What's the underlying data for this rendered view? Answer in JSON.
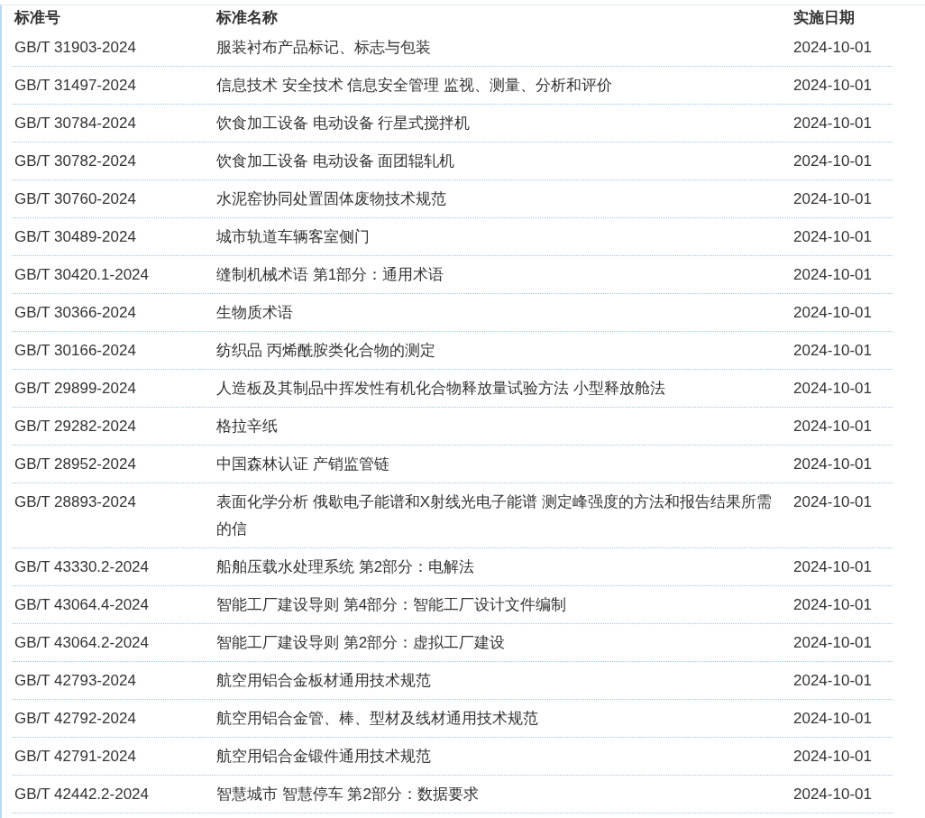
{
  "table": {
    "columns": [
      "标准号",
      "标准名称",
      "实施日期"
    ],
    "rows": [
      {
        "code": "GB/T 31903-2024",
        "name": "服装衬布产品标记、标志与包装",
        "date": "2024-10-01"
      },
      {
        "code": "GB/T 31497-2024",
        "name": "信息技术 安全技术 信息安全管理 监视、测量、分析和评价",
        "date": "2024-10-01"
      },
      {
        "code": "GB/T 30784-2024",
        "name": "饮食加工设备 电动设备 行星式搅拌机",
        "date": "2024-10-01"
      },
      {
        "code": "GB/T 30782-2024",
        "name": "饮食加工设备 电动设备 面团辊轧机",
        "date": "2024-10-01"
      },
      {
        "code": "GB/T 30760-2024",
        "name": "水泥窑协同处置固体废物技术规范",
        "date": "2024-10-01"
      },
      {
        "code": "GB/T 30489-2024",
        "name": "城市轨道车辆客室侧门",
        "date": "2024-10-01"
      },
      {
        "code": "GB/T 30420.1-2024",
        "name": "缝制机械术语 第1部分：通用术语",
        "date": "2024-10-01"
      },
      {
        "code": "GB/T 30366-2024",
        "name": "生物质术语",
        "date": "2024-10-01"
      },
      {
        "code": "GB/T 30166-2024",
        "name": "纺织品 丙烯酰胺类化合物的测定",
        "date": "2024-10-01"
      },
      {
        "code": "GB/T 29899-2024",
        "name": "人造板及其制品中挥发性有机化合物释放量试验方法 小型释放舱法",
        "date": "2024-10-01"
      },
      {
        "code": "GB/T 29282-2024",
        "name": "格拉辛纸",
        "date": "2024-10-01"
      },
      {
        "code": "GB/T 28952-2024",
        "name": "中国森林认证 产销监管链",
        "date": "2024-10-01"
      },
      {
        "code": "GB/T 28893-2024",
        "name": "表面化学分析 俄歇电子能谱和X射线光电子能谱 测定峰强度的方法和报告结果所需的信",
        "date": "2024-10-01"
      },
      {
        "code": "GB/T 43330.2-2024",
        "name": "船舶压载水处理系统 第2部分：电解法",
        "date": "2024-10-01"
      },
      {
        "code": "GB/T 43064.4-2024",
        "name": "智能工厂建设导则 第4部分：智能工厂设计文件编制",
        "date": "2024-10-01"
      },
      {
        "code": "GB/T 43064.2-2024",
        "name": "智能工厂建设导则 第2部分：虚拟工厂建设",
        "date": "2024-10-01"
      },
      {
        "code": "GB/T 42793-2024",
        "name": "航空用铝合金板材通用技术规范",
        "date": "2024-10-01"
      },
      {
        "code": "GB/T 42792-2024",
        "name": "航空用铝合金管、棒、型材及线材通用技术规范",
        "date": "2024-10-01"
      },
      {
        "code": "GB/T 42791-2024",
        "name": "航空用铝合金锻件通用技术规范",
        "date": "2024-10-01"
      },
      {
        "code": "GB/T 42442.2-2024",
        "name": "智慧城市 智慧停车 第2部分：数据要求",
        "date": "2024-10-01"
      }
    ]
  }
}
